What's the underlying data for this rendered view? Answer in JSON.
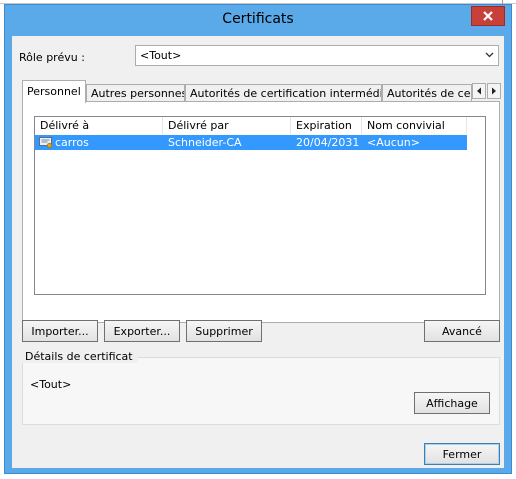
{
  "window": {
    "title": "Certificats",
    "close_icon": "close-icon"
  },
  "role": {
    "label": "Rôle prévu :",
    "value": "<Tout>"
  },
  "tabs": [
    {
      "label": "Personnel",
      "active": true
    },
    {
      "label": "Autres personnes",
      "active": false
    },
    {
      "label": "Autorités de certification intermédiaires",
      "active": false
    },
    {
      "label": "Autorités de certi",
      "active": false
    }
  ],
  "tab_scroll": {
    "left_icon": "chevron-left-icon",
    "right_icon": "chevron-right-icon"
  },
  "list": {
    "columns": [
      "Délivré à",
      "Délivré par",
      "Expiration",
      "Nom convivial"
    ],
    "rows": [
      {
        "icon": "certificate-icon",
        "issued_to": "carros",
        "issued_by": "Schneider-CA",
        "expiration": "20/04/2031",
        "friendly_name": "<Aucun>",
        "selected": true
      }
    ]
  },
  "buttons": {
    "import": "Importer...",
    "export": "Exporter...",
    "delete": "Supprimer",
    "advanced": "Avancé",
    "view": "Affichage",
    "close": "Fermer"
  },
  "details": {
    "title": "Détails de certificat",
    "value": "<Tout>"
  },
  "colors": {
    "titlebar": "#5aa9e8",
    "close_button": "#c7403a",
    "selection": "#3399ff"
  }
}
